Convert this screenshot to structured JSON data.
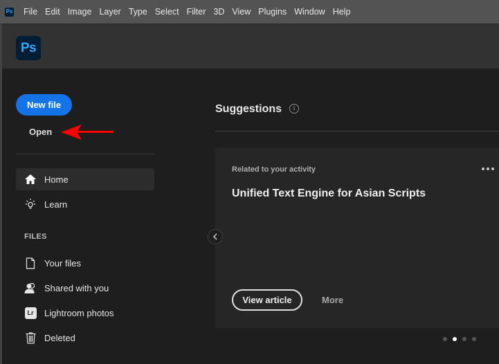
{
  "menubar": {
    "app_icon": "Ps",
    "items": [
      "File",
      "Edit",
      "Image",
      "Layer",
      "Type",
      "Select",
      "Filter",
      "3D",
      "View",
      "Plugins",
      "Window",
      "Help"
    ]
  },
  "header": {
    "logo": "Ps"
  },
  "sidebar": {
    "new_file_label": "New file",
    "open_label": "Open",
    "nav": [
      {
        "label": "Home",
        "icon": "home-icon",
        "active": true
      },
      {
        "label": "Learn",
        "icon": "lightbulb-icon",
        "active": false
      }
    ],
    "files_section_label": "FILES",
    "files": [
      {
        "label": "Your files",
        "icon": "document-icon"
      },
      {
        "label": "Shared with you",
        "icon": "people-icon"
      },
      {
        "label": "Lightroom photos",
        "icon": "lightroom-icon",
        "badge": "Lr"
      },
      {
        "label": "Deleted",
        "icon": "trash-icon"
      }
    ]
  },
  "main": {
    "suggestions_title": "Suggestions",
    "info_glyph": "i",
    "card": {
      "kicker": "Related to your activity",
      "title": "Unified Text Engine for Asian Scripts",
      "primary_label": "View article",
      "secondary_label": "More"
    },
    "carousel": {
      "total": 4,
      "active_index": 1
    }
  },
  "colors": {
    "accent": "#1473e6",
    "annotation_arrow": "#ff0000",
    "ps_brand_bg": "#001e36",
    "ps_brand_fg": "#31a8ff"
  }
}
